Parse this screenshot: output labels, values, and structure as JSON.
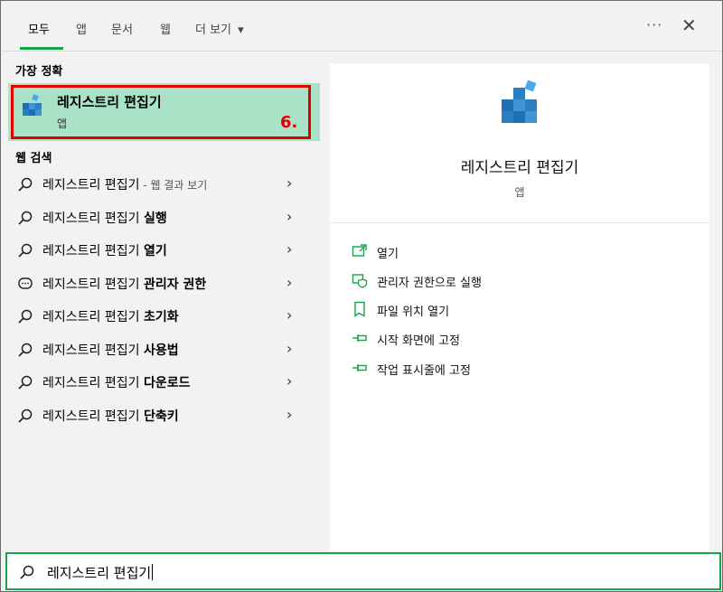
{
  "tabs": [
    {
      "label": "모두"
    },
    {
      "label": "앱"
    },
    {
      "label": "문서"
    },
    {
      "label": "웹"
    },
    {
      "label": "더 보기"
    }
  ],
  "more_caret": "▾",
  "ellipsis": "···",
  "close_glyph": "✕",
  "best_match": {
    "section_label": "가장 정확",
    "title": "레지스트리 편집기",
    "subtitle": "앱",
    "annotation": "6."
  },
  "web_search": {
    "section_label": "웹 검색",
    "items": [
      {
        "prefix": "레지스트리 편집기",
        "bold": "",
        "suffix": " - 웹 결과 보기",
        "icon": "search-icon"
      },
      {
        "prefix": "레지스트리 편집기 ",
        "bold": "실행",
        "suffix": "",
        "icon": "search-icon"
      },
      {
        "prefix": "레지스트리 편집기 ",
        "bold": "열기",
        "suffix": "",
        "icon": "search-icon"
      },
      {
        "prefix": "레지스트리 편집기 ",
        "bold": "관리자 권한",
        "suffix": "",
        "icon": "chat-icon"
      },
      {
        "prefix": "레지스트리 편집기 ",
        "bold": "초기화",
        "suffix": "",
        "icon": "search-icon"
      },
      {
        "prefix": "레지스트리 편집기 ",
        "bold": "사용법",
        "suffix": "",
        "icon": "search-icon"
      },
      {
        "prefix": "레지스트리 편집기 ",
        "bold": "다운로드",
        "suffix": "",
        "icon": "search-icon"
      },
      {
        "prefix": "레지스트리 편집기 ",
        "bold": "단축키",
        "suffix": "",
        "icon": "search-icon"
      }
    ],
    "chevron": "›"
  },
  "detail": {
    "title": "레지스트리 편집기",
    "subtitle": "앱",
    "actions": [
      {
        "label": "열기",
        "icon": "open-icon"
      },
      {
        "label": "관리자 권한으로 실행",
        "icon": "admin-shield-icon"
      },
      {
        "label": "파일 위치 열기",
        "icon": "file-location-icon"
      },
      {
        "label": "시작 화면에 고정",
        "icon": "pin-icon"
      },
      {
        "label": "작업 표시줄에 고정",
        "icon": "pin-icon"
      }
    ]
  },
  "search": {
    "value": "레지스트리 편집기"
  },
  "colors": {
    "accent": "#16a34a",
    "highlight": "#a9e2c6",
    "annotation": "#e00000"
  }
}
